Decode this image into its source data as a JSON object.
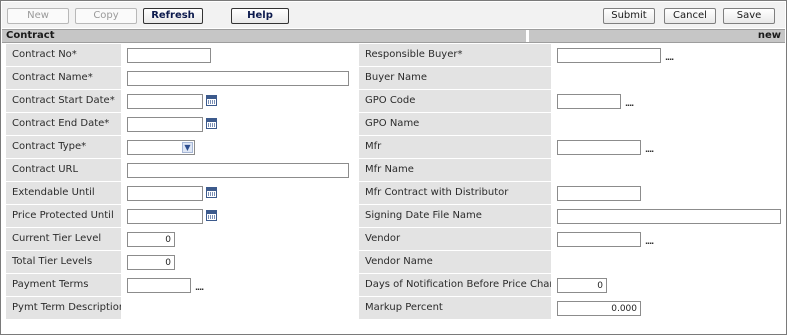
{
  "toolbar": {
    "new": "New",
    "copy": "Copy",
    "refresh": "Refresh",
    "help": "Help",
    "submit": "Submit",
    "cancel": "Cancel",
    "save": "Save"
  },
  "section": {
    "title": "Contract",
    "status": "new"
  },
  "left": [
    {
      "label": "Contract No*",
      "value": ""
    },
    {
      "label": "Contract Name*",
      "value": ""
    },
    {
      "label": "Contract Start Date*",
      "value": ""
    },
    {
      "label": "Contract End Date*",
      "value": ""
    },
    {
      "label": "Contract Type*",
      "value": ""
    },
    {
      "label": "Contract URL",
      "value": ""
    },
    {
      "label": "Extendable Until",
      "value": ""
    },
    {
      "label": "Price Protected Until",
      "value": ""
    },
    {
      "label": "Current Tier Level",
      "value": "0"
    },
    {
      "label": "Total Tier Levels",
      "value": "0"
    },
    {
      "label": "Payment Terms",
      "value": ""
    },
    {
      "label": "Pymt Term Description",
      "value": ""
    }
  ],
  "right": [
    {
      "label": "Responsible Buyer*",
      "value": ""
    },
    {
      "label": "Buyer Name",
      "value": ""
    },
    {
      "label": "GPO Code",
      "value": ""
    },
    {
      "label": "GPO Name",
      "value": ""
    },
    {
      "label": "Mfr",
      "value": ""
    },
    {
      "label": "Mfr Name",
      "value": ""
    },
    {
      "label": "Mfr Contract with Distributor",
      "value": ""
    },
    {
      "label": "Signing Date File Name",
      "value": ""
    },
    {
      "label": "Vendor",
      "value": ""
    },
    {
      "label": "Vendor Name",
      "value": ""
    },
    {
      "label": "Days of Notification Before Price Change",
      "value": "0"
    },
    {
      "label": "Markup Percent",
      "value": "0.000"
    }
  ],
  "colors": {
    "label_bg": "#e3e3e3",
    "section_bg": "#c6c6c6",
    "toolbar_bg": "#f2f2f2"
  },
  "icons": {
    "calendar": "calendar-icon",
    "lookup": "lookup-ellipsis-icon",
    "dropdown": "chevron-down-icon"
  }
}
